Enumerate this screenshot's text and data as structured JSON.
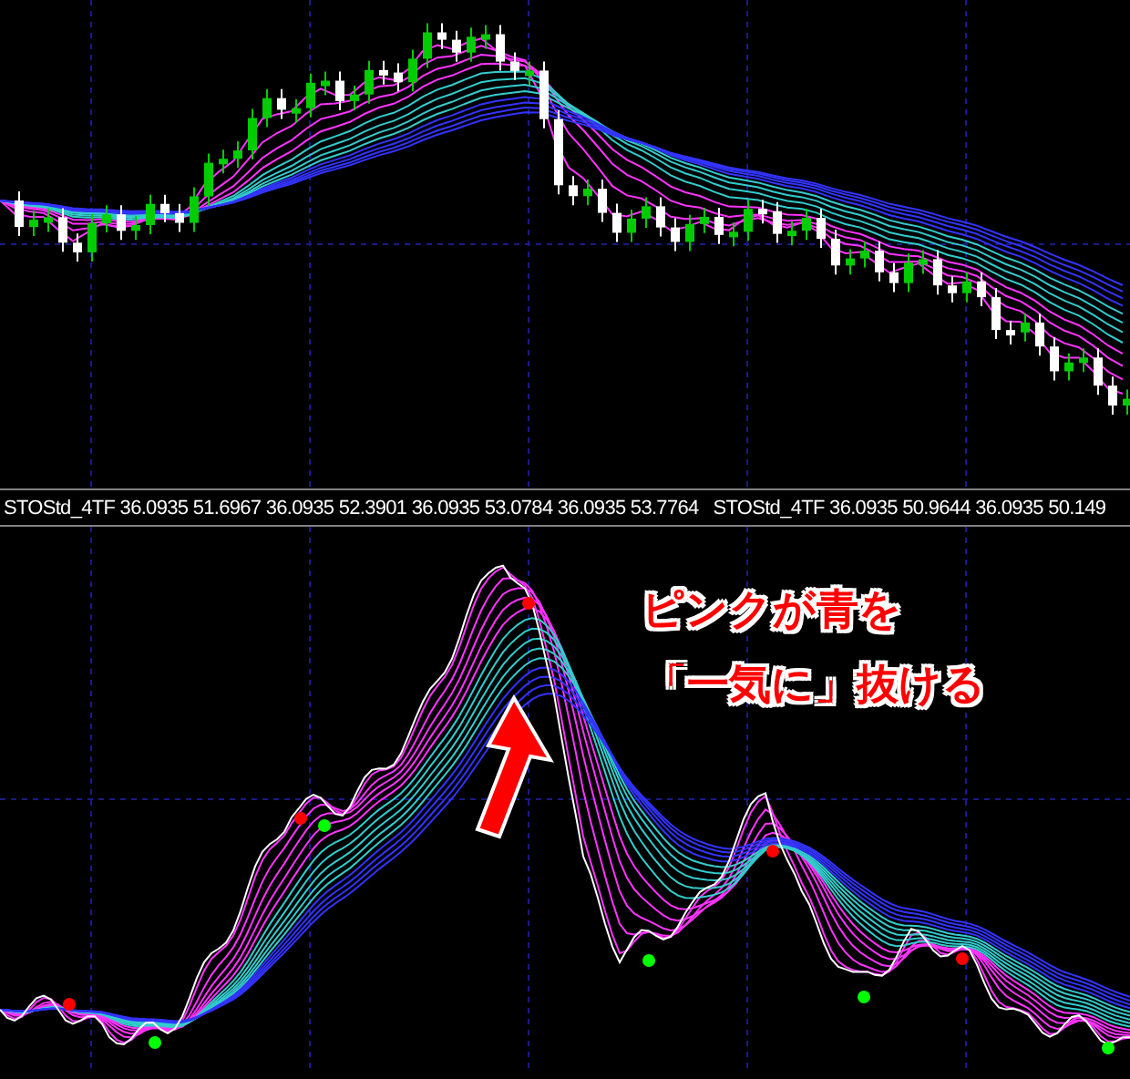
{
  "indicator_labels": [
    {
      "name": "STOStd_4TF",
      "values": [
        "36.0935",
        "51.6967",
        "36.0935",
        "52.3901",
        "36.0935",
        "53.0784",
        "36.0935",
        "53.7764"
      ]
    },
    {
      "name": "STOStd_4TF",
      "values": [
        "36.0935",
        "50.9644",
        "36.0935",
        "50.149"
      ]
    }
  ],
  "annotation": {
    "lines": [
      "ピンクが青を",
      "「一気に」抜ける"
    ]
  }
}
